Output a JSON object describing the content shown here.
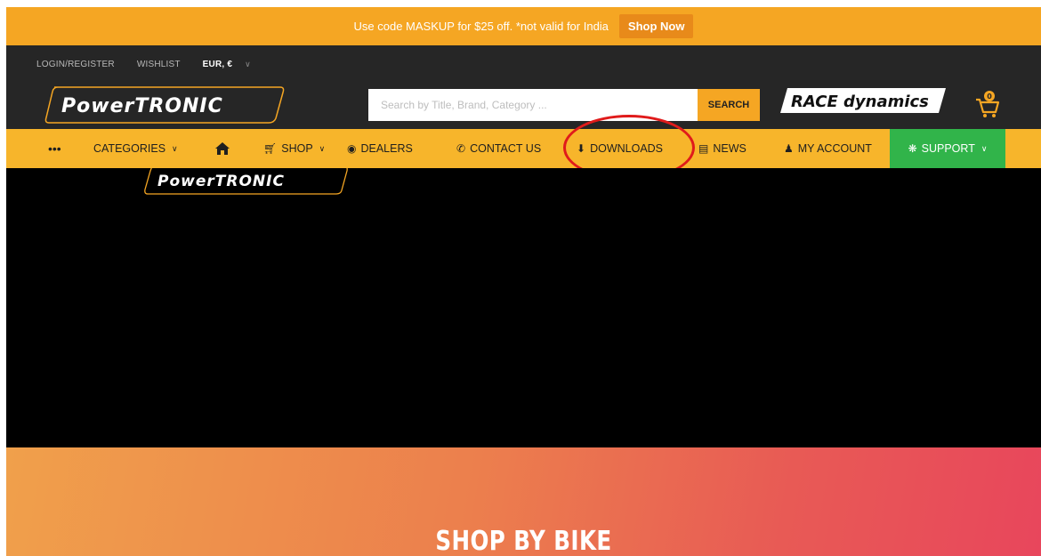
{
  "promo": {
    "text": "Use code MASKUP for $25 off. *not valid for India",
    "button": "Shop Now"
  },
  "topbar": {
    "login": "LOGIN/REGISTER",
    "wishlist": "WISHLIST",
    "currency": "EUR, €"
  },
  "header": {
    "logo_text": "PowerTRONIC",
    "search_placeholder": "Search by Title, Brand, Category ...",
    "search_button": "SEARCH",
    "partner_logo": "RACE dynamics",
    "cart_count": "0"
  },
  "nav": {
    "more": "•••",
    "categories": "CATEGORIES",
    "shop": "SHOP",
    "dealers": "DEALERS",
    "contact": "CONTACT US",
    "downloads": "DOWNLOADS",
    "news": "NEWS",
    "account": "MY ACCOUNT",
    "support": "SUPPORT"
  },
  "hero": {
    "logo_text": "PowerTRONIC"
  },
  "shop_section": {
    "title": "SHOP BY BIKE"
  },
  "colors": {
    "accent": "#f7b52b",
    "dark": "#262626",
    "support": "#31b44a",
    "annotation": "#e01b1b"
  },
  "icons": [
    "home-icon",
    "cart-icon",
    "globe-icon",
    "phone-icon",
    "download-icon",
    "news-icon",
    "user-icon",
    "support-icon",
    "chevron-down-icon"
  ]
}
